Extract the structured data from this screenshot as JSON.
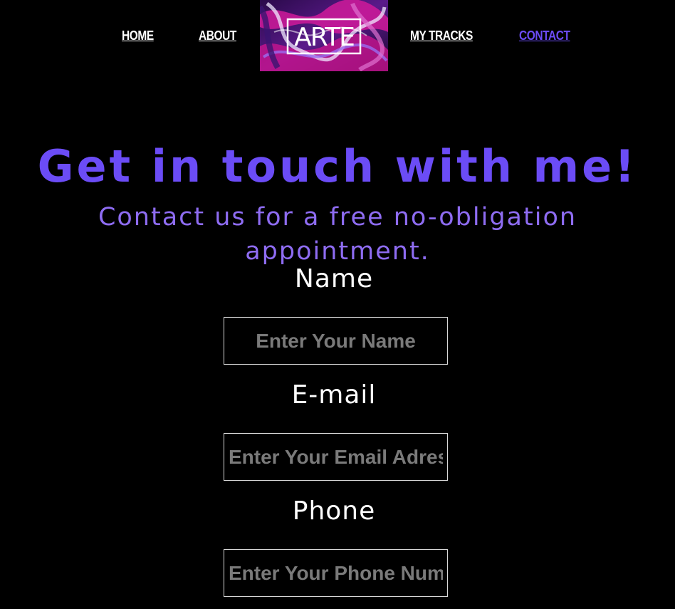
{
  "nav": {
    "home": "HOME",
    "about": "ABOUT",
    "logo_text": "ARTE",
    "tracks": "MY TRACKS",
    "contact": "CONTACT",
    "active": "contact"
  },
  "hero": {
    "title": "Get in touch with me!",
    "subtitle": "Contact us for a free no-obligation appointment."
  },
  "form": {
    "name_label": "Name",
    "name_placeholder": "Enter Your Name",
    "email_label": "E-mail",
    "email_placeholder": "Enter Your Email Adress",
    "phone_label": "Phone",
    "phone_placeholder": "Enter Your Phone Number"
  },
  "colors": {
    "background": "#000000",
    "accent": "#6b4cf6",
    "subtitle": "#8e6cf2",
    "text": "#ffffff",
    "placeholder": "#7a7a7a"
  }
}
